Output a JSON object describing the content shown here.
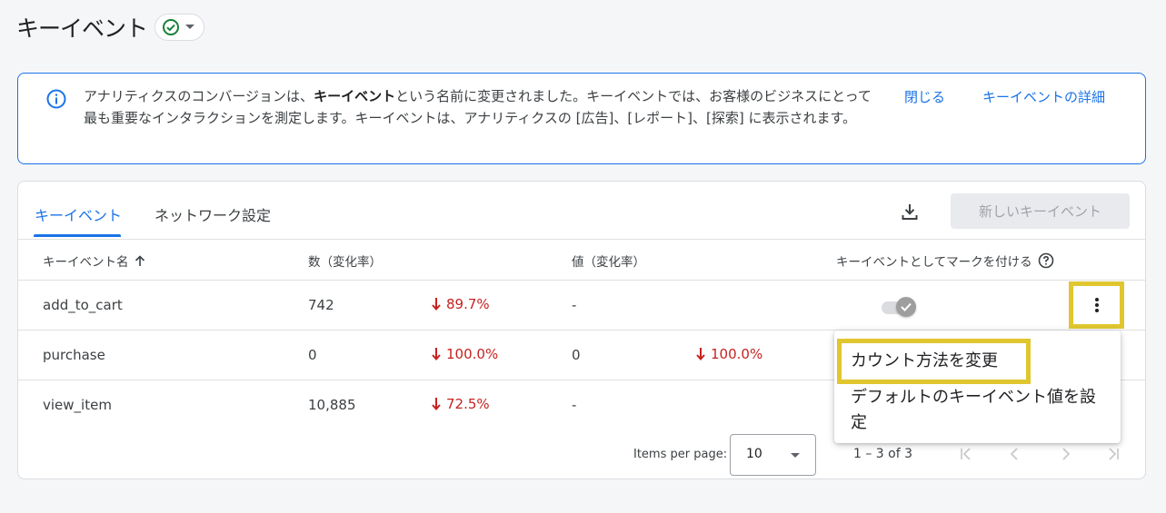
{
  "header": {
    "title": "キーイベント",
    "status_icon": "check-circle-icon"
  },
  "banner": {
    "message_before": "アナリティクスのコンバージョンは、",
    "message_bold": "キーイベント",
    "message_after": "という名前に変更されました。キーイベントでは、お客様のビジネスにとって最も重要なインタラクションを測定します。キーイベントは、アナリティクスの [広告]、[レポート]、[探索] に表示されます。",
    "close_label": "閉じる",
    "details_label": "キーイベントの詳細"
  },
  "tabs": [
    {
      "label": "キーイベント",
      "active": true
    },
    {
      "label": "ネットワーク設定",
      "active": false
    }
  ],
  "toolbar": {
    "new_button_label": "新しいキーイベント"
  },
  "table": {
    "columns": [
      "キーイベント名",
      "数（変化率）",
      "値（変化率）",
      "キーイベントとしてマークを付ける"
    ],
    "rows": [
      {
        "name": "add_to_cart",
        "count": "742",
        "count_change": "89.7%",
        "value": "-",
        "value_change": ""
      },
      {
        "name": "purchase",
        "count": "0",
        "count_change": "100.0%",
        "value": "0",
        "value_change": "100.0%"
      },
      {
        "name": "view_item",
        "count": "10,885",
        "count_change": "72.5%",
        "value": "-",
        "value_change": ""
      }
    ]
  },
  "pagination": {
    "items_per_page_label": "Items per page:",
    "items_per_page": "10",
    "range": "1 – 3 of 3"
  },
  "context_menu": {
    "items": [
      "カウント方法を変更",
      "デフォルトのキーイベント値を設定"
    ]
  },
  "colors": {
    "accent": "#1a73e8",
    "negative": "#c5221f",
    "highlight": "#e0c62f",
    "success": "#188038"
  }
}
